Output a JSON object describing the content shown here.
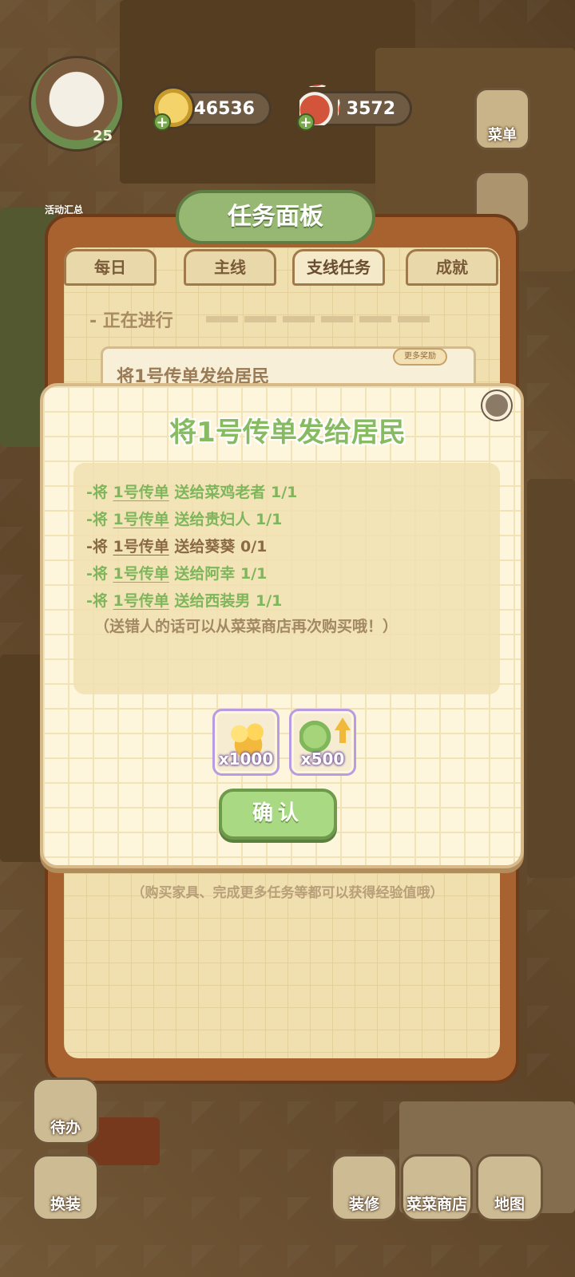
{
  "hud": {
    "level": "25",
    "coins": "46536",
    "meat": "3572",
    "menu_label": "菜单",
    "activity_label": "活动汇总"
  },
  "panel": {
    "title": "任务面板",
    "tabs": [
      "每日",
      "主线",
      "支线任务",
      "成就"
    ],
    "active_tab": "支线任务",
    "section_heading": "- 正在进行",
    "task_card_title": "将1号传单发给居民",
    "more_reward_label": "更多奖励",
    "footer_note": "（购买家具、完成更多任务等都可以获得经验值哦）"
  },
  "modal": {
    "title": "将1号传单发给居民",
    "requirements": [
      {
        "prefix": "-将 ",
        "item": "1号传单",
        "rest": " 送给菜鸡老者 1/1",
        "done": true
      },
      {
        "prefix": "-将 ",
        "item": "1号传单",
        "rest": " 送给贵妇人 1/1",
        "done": true
      },
      {
        "prefix": "-将 ",
        "item": "1号传单",
        "rest": " 送给葵葵 0/1",
        "done": false
      },
      {
        "prefix": "-将 ",
        "item": "1号传单",
        "rest": " 送给阿幸 1/1",
        "done": true
      },
      {
        "prefix": "-将 ",
        "item": "1号传单",
        "rest": " 送给西装男 1/1",
        "done": true
      }
    ],
    "note": "（送错人的话可以从菜菜商店再次购买哦！）",
    "rewards": [
      {
        "icon": "gold-coins-icon",
        "qty": "x1000"
      },
      {
        "icon": "vegetable-exp-icon",
        "qty": "x500"
      }
    ],
    "confirm_label": "确认"
  },
  "bottom_nav": {
    "todo_label": "待办",
    "dressup_label": "换装",
    "decorate_label": "装修",
    "shop_label": "菜菜商店",
    "map_label": "地图"
  },
  "colors": {
    "done": "#7fb55b",
    "pending": "#8a6a44",
    "title": "#86bb61",
    "confirm": "#a9d983"
  }
}
